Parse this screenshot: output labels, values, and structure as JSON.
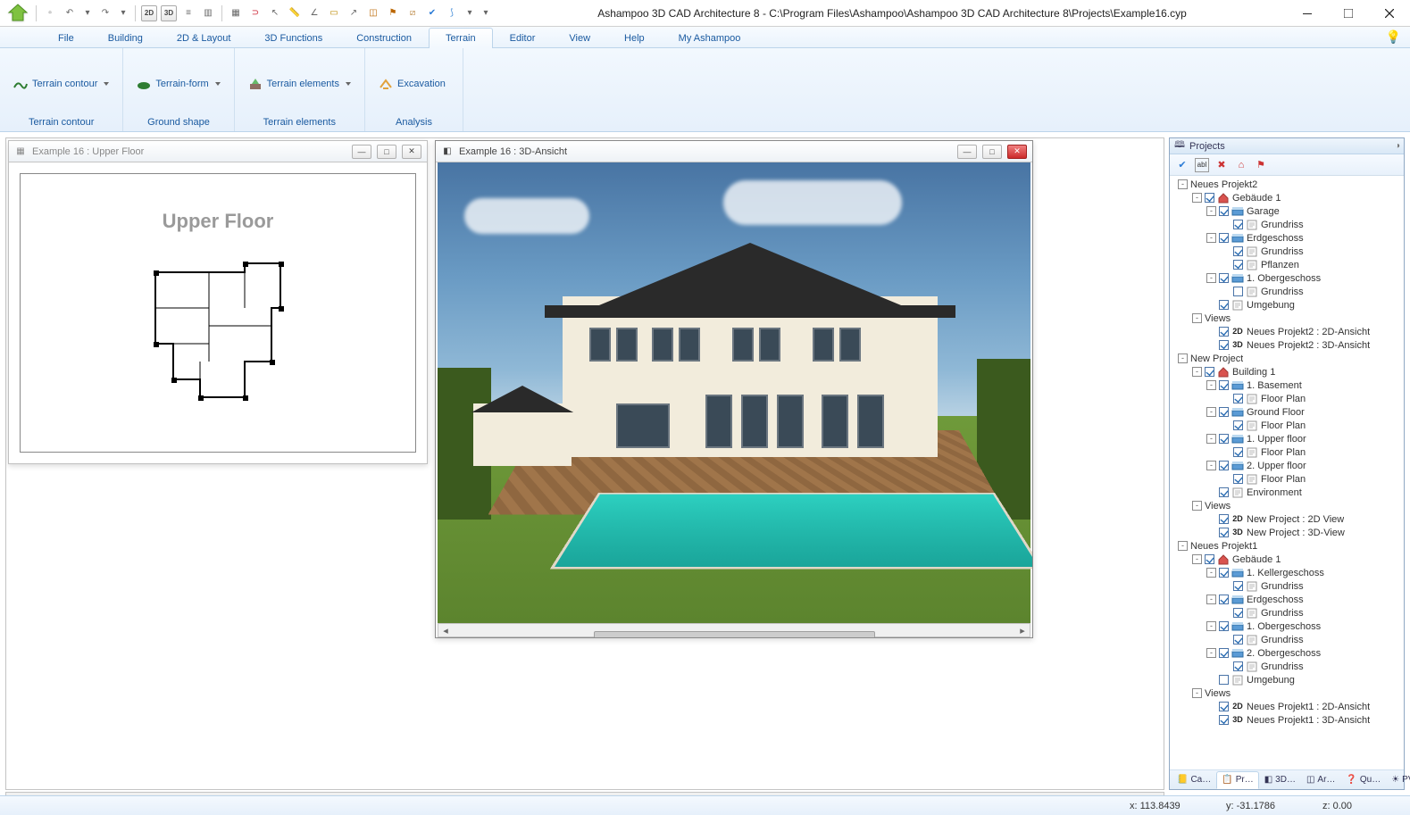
{
  "title": "Ashampoo 3D CAD Architecture 8 - C:\\Program Files\\Ashampoo\\Ashampoo 3D CAD Architecture 8\\Projects\\Example16.cyp",
  "qat": {
    "btn2d": "2D",
    "btn3d": "3D"
  },
  "menu": {
    "items": [
      "File",
      "Building",
      "2D & Layout",
      "3D Functions",
      "Construction",
      "Terrain",
      "Editor",
      "View",
      "Help",
      "My Ashampoo"
    ],
    "activeIndex": 5
  },
  "ribbon": {
    "groups": [
      {
        "caption": "Terrain contour",
        "btn": "Terrain contour",
        "hasCaret": true
      },
      {
        "caption": "Ground shape",
        "btn": "Terrain-form",
        "hasCaret": true
      },
      {
        "caption": "Terrain elements",
        "btn": "Terrain elements",
        "hasCaret": true
      },
      {
        "caption": "Analysis",
        "btn": "Excavation",
        "hasCaret": false
      }
    ]
  },
  "views": {
    "left": {
      "title": "Example 16 : Upper Floor",
      "heading": "Upper Floor"
    },
    "right": {
      "title": "Example 16 : 3D-Ansicht"
    }
  },
  "projects": {
    "panelTitle": "Projects",
    "tree": [
      {
        "d": 0,
        "tw": "-",
        "ck": null,
        "icon": "",
        "label": "Neues Projekt2"
      },
      {
        "d": 1,
        "tw": "-",
        "ck": true,
        "icon": "house",
        "label": "Gebäude 1"
      },
      {
        "d": 2,
        "tw": "-",
        "ck": true,
        "icon": "floor",
        "label": "Garage"
      },
      {
        "d": 3,
        "tw": "",
        "ck": true,
        "icon": "doc",
        "label": "Grundriss"
      },
      {
        "d": 2,
        "tw": "-",
        "ck": true,
        "icon": "floor",
        "label": "Erdgeschoss"
      },
      {
        "d": 3,
        "tw": "",
        "ck": true,
        "icon": "doc",
        "label": "Grundriss"
      },
      {
        "d": 3,
        "tw": "",
        "ck": true,
        "icon": "doc",
        "label": "Pflanzen"
      },
      {
        "d": 2,
        "tw": "-",
        "ck": true,
        "icon": "floor",
        "label": "1. Obergeschoss"
      },
      {
        "d": 3,
        "tw": "",
        "ck": false,
        "icon": "doc",
        "label": "Grundriss"
      },
      {
        "d": 2,
        "tw": "",
        "ck": true,
        "icon": "doc",
        "label": "Umgebung"
      },
      {
        "d": 1,
        "tw": "-",
        "ck": null,
        "icon": "",
        "label": "Views"
      },
      {
        "d": 2,
        "tw": "",
        "ck": true,
        "icon": "2d",
        "label": "Neues Projekt2 : 2D-Ansicht"
      },
      {
        "d": 2,
        "tw": "",
        "ck": true,
        "icon": "3d",
        "label": "Neues Projekt2 : 3D-Ansicht"
      },
      {
        "d": 0,
        "tw": "-",
        "ck": null,
        "icon": "",
        "label": "New Project"
      },
      {
        "d": 1,
        "tw": "-",
        "ck": true,
        "icon": "house",
        "label": "Building 1"
      },
      {
        "d": 2,
        "tw": "-",
        "ck": true,
        "icon": "floor",
        "label": "1. Basement"
      },
      {
        "d": 3,
        "tw": "",
        "ck": true,
        "icon": "doc",
        "label": "Floor Plan"
      },
      {
        "d": 2,
        "tw": "-",
        "ck": true,
        "icon": "floor",
        "label": "Ground Floor"
      },
      {
        "d": 3,
        "tw": "",
        "ck": true,
        "icon": "doc",
        "label": "Floor Plan"
      },
      {
        "d": 2,
        "tw": "-",
        "ck": true,
        "icon": "floor",
        "label": "1. Upper floor"
      },
      {
        "d": 3,
        "tw": "",
        "ck": true,
        "icon": "doc",
        "label": "Floor Plan"
      },
      {
        "d": 2,
        "tw": "-",
        "ck": true,
        "icon": "floor",
        "label": "2. Upper floor"
      },
      {
        "d": 3,
        "tw": "",
        "ck": true,
        "icon": "doc",
        "label": "Floor Plan"
      },
      {
        "d": 2,
        "tw": "",
        "ck": true,
        "icon": "doc",
        "label": "Environment"
      },
      {
        "d": 1,
        "tw": "-",
        "ck": null,
        "icon": "",
        "label": "Views"
      },
      {
        "d": 2,
        "tw": "",
        "ck": true,
        "icon": "2d",
        "label": "New Project : 2D View"
      },
      {
        "d": 2,
        "tw": "",
        "ck": true,
        "icon": "3d",
        "label": "New Project : 3D-View"
      },
      {
        "d": 0,
        "tw": "-",
        "ck": null,
        "icon": "",
        "label": "Neues Projekt1"
      },
      {
        "d": 1,
        "tw": "-",
        "ck": true,
        "icon": "house",
        "label": "Gebäude 1"
      },
      {
        "d": 2,
        "tw": "-",
        "ck": true,
        "icon": "floor",
        "label": "1. Kellergeschoss"
      },
      {
        "d": 3,
        "tw": "",
        "ck": true,
        "icon": "doc",
        "label": "Grundriss"
      },
      {
        "d": 2,
        "tw": "-",
        "ck": true,
        "icon": "floor",
        "label": "Erdgeschoss"
      },
      {
        "d": 3,
        "tw": "",
        "ck": true,
        "icon": "doc",
        "label": "Grundriss"
      },
      {
        "d": 2,
        "tw": "-",
        "ck": true,
        "icon": "floor",
        "label": "1. Obergeschoss"
      },
      {
        "d": 3,
        "tw": "",
        "ck": true,
        "icon": "doc",
        "label": "Grundriss"
      },
      {
        "d": 2,
        "tw": "-",
        "ck": true,
        "icon": "floor",
        "label": "2. Obergeschoss"
      },
      {
        "d": 3,
        "tw": "",
        "ck": true,
        "icon": "doc",
        "label": "Grundriss"
      },
      {
        "d": 2,
        "tw": "",
        "ck": false,
        "icon": "doc",
        "label": "Umgebung"
      },
      {
        "d": 1,
        "tw": "-",
        "ck": null,
        "icon": "",
        "label": "Views"
      },
      {
        "d": 2,
        "tw": "",
        "ck": true,
        "icon": "2d",
        "label": "Neues Projekt1 : 2D-Ansicht"
      },
      {
        "d": 2,
        "tw": "",
        "ck": true,
        "icon": "3d",
        "label": "Neues Projekt1 : 3D-Ansicht"
      }
    ]
  },
  "bottomTabs": [
    "Ca…",
    "Pr…",
    "3D…",
    "Ar…",
    "Qu…",
    "PV…"
  ],
  "status": {
    "x": "x: 113.8439",
    "y": "y: -31.1786",
    "z": "z: 0.00"
  }
}
